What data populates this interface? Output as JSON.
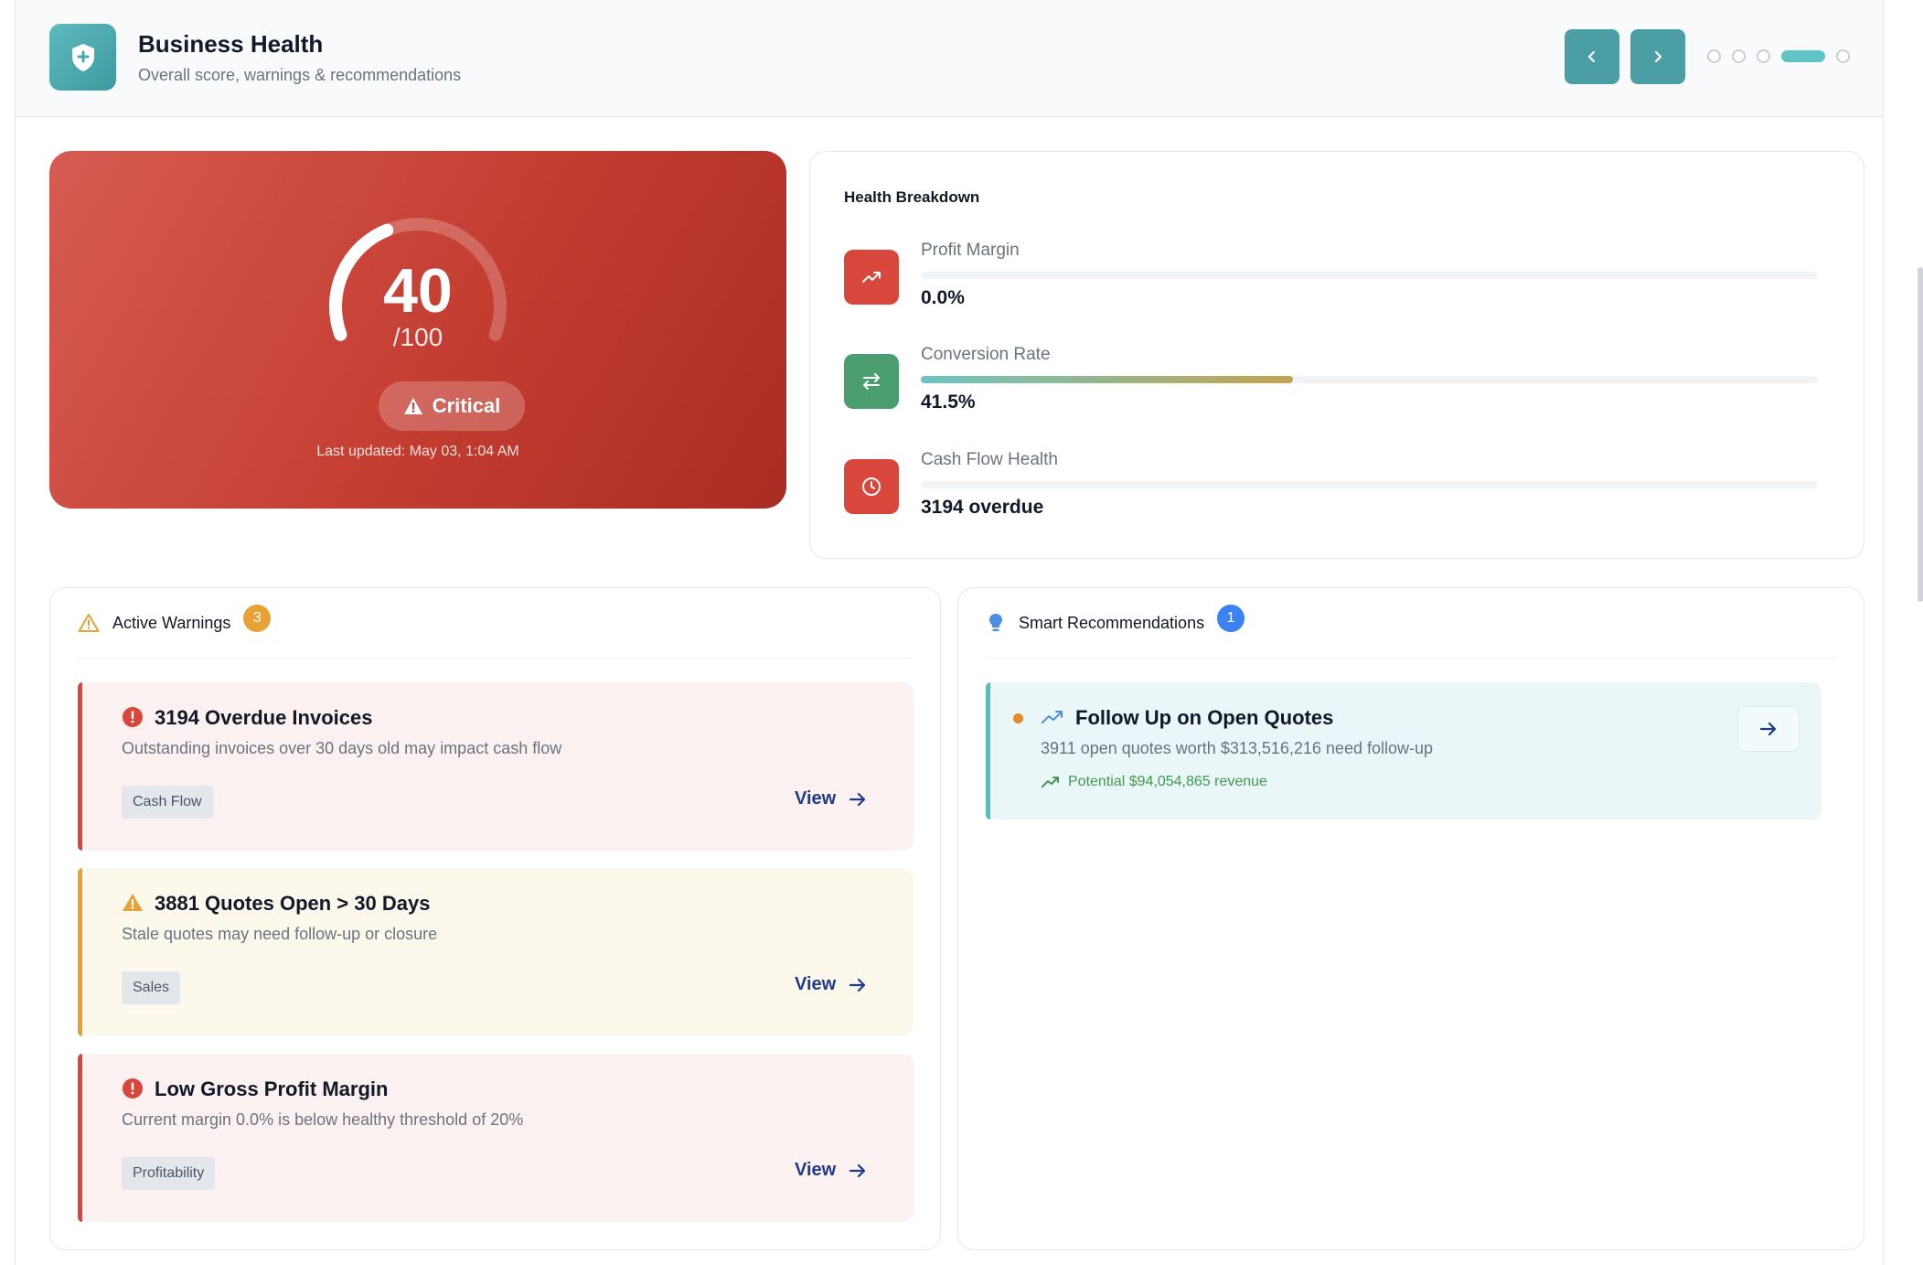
{
  "header": {
    "title": "Business Health",
    "subtitle": "Overall score, warnings & recommendations",
    "icon": "shield-plus-icon"
  },
  "carousel": {
    "total": 5,
    "active_index": 3
  },
  "score": {
    "value": "40",
    "max_label": "/100",
    "fraction": 0.4,
    "status": "Critical",
    "updated": "Last updated: May 03, 1:04 AM"
  },
  "breakdown": {
    "title": "Health Breakdown",
    "metrics": [
      {
        "label": "Profit Margin",
        "value": "0.0%",
        "progress": 0.0,
        "icon": "trend-up-icon",
        "color": "#d9463b"
      },
      {
        "label": "Conversion Rate",
        "value": "41.5%",
        "progress": 0.415,
        "icon": "swap-arrows-icon",
        "color": "#4a9e6f"
      },
      {
        "label": "Cash Flow Health",
        "value": "3194 overdue",
        "progress": 0.0,
        "icon": "clock-icon",
        "color": "#d9463b"
      }
    ]
  },
  "warnings": {
    "title": "Active Warnings",
    "count": "3",
    "view_label": "View",
    "items": [
      {
        "title": "3194 Overdue Invoices",
        "description": "Outstanding invoices over 30 days old may impact cash flow",
        "tag": "Cash Flow",
        "severity": "critical"
      },
      {
        "title": "3881 Quotes Open > 30 Days",
        "description": "Stale quotes may need follow-up or closure",
        "tag": "Sales",
        "severity": "warning"
      },
      {
        "title": "Low Gross Profit Margin",
        "description": "Current margin 0.0% is below healthy threshold of 20%",
        "tag": "Profitability",
        "severity": "critical"
      }
    ]
  },
  "recommendations": {
    "title": "Smart Recommendations",
    "count": "1",
    "items": [
      {
        "title": "Follow Up on Open Quotes",
        "description": "3911 open quotes worth $313,516,216 need follow-up",
        "potential": "Potential $94,054,865 revenue"
      }
    ]
  },
  "colors": {
    "accent": "#4b9ea3",
    "critical": "#d9463b",
    "warning": "#e8a234",
    "info": "#3b82f6",
    "success": "#3f9a4f"
  }
}
